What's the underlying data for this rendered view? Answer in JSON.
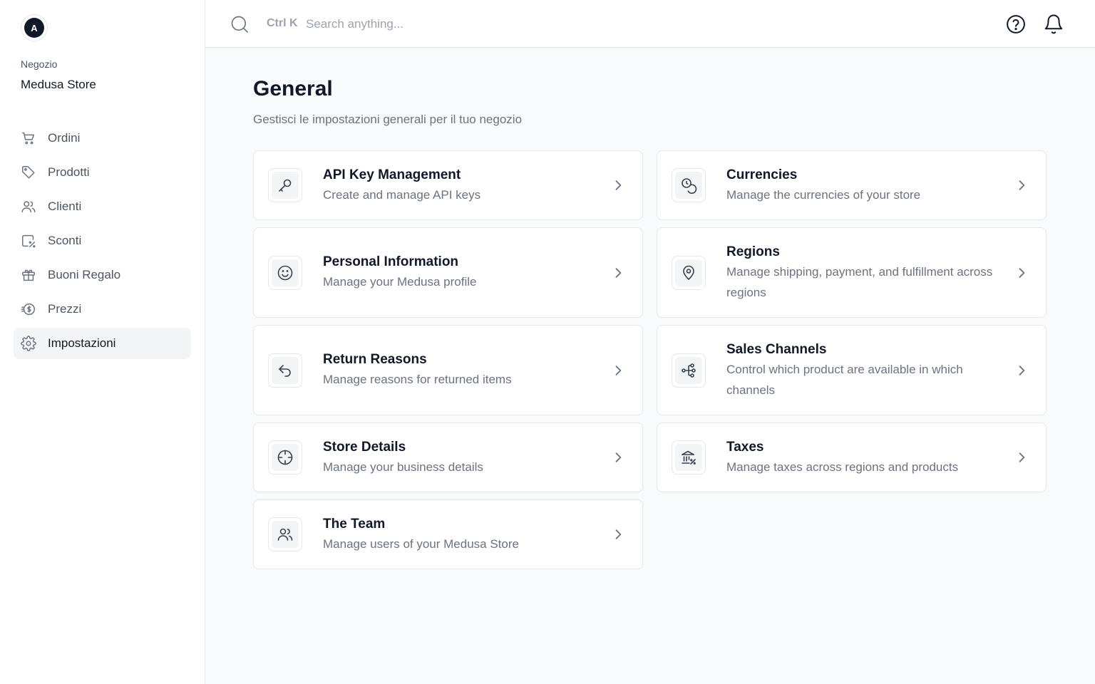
{
  "app": {
    "avatar_initial": "A",
    "store_label": "Negozio",
    "store_name": "Medusa Store"
  },
  "sidebar": {
    "items": [
      {
        "label": "Ordini",
        "icon": "cart-icon"
      },
      {
        "label": "Prodotti",
        "icon": "tag-icon"
      },
      {
        "label": "Clienti",
        "icon": "users-icon"
      },
      {
        "label": "Sconti",
        "icon": "discount-icon"
      },
      {
        "label": "Buoni Regalo",
        "icon": "gift-icon"
      },
      {
        "label": "Prezzi",
        "icon": "coin-icon"
      },
      {
        "label": "Impostazioni",
        "icon": "gear-icon",
        "active": true
      }
    ]
  },
  "topbar": {
    "shortcut": "Ctrl K",
    "search_placeholder": "Search anything..."
  },
  "page": {
    "title": "General",
    "subtitle": "Gestisci le impostazioni generali per il tuo negozio"
  },
  "cards": [
    {
      "title": "API Key Management",
      "desc": "Create and manage API keys",
      "icon": "key-icon"
    },
    {
      "title": "Currencies",
      "desc": "Manage the currencies of your store",
      "icon": "coins-icon"
    },
    {
      "title": "Personal Information",
      "desc": "Manage your Medusa profile",
      "icon": "smiley-icon"
    },
    {
      "title": "Regions",
      "desc": "Manage shipping, payment, and fulfillment across regions",
      "icon": "map-pin-icon"
    },
    {
      "title": "Return Reasons",
      "desc": "Manage reasons for returned items",
      "icon": "return-arrow-icon"
    },
    {
      "title": "Sales Channels",
      "desc": "Control which product are available in which channels",
      "icon": "channels-icon"
    },
    {
      "title": "Store Details",
      "desc": "Manage your business details",
      "icon": "crosshair-icon"
    },
    {
      "title": "Taxes",
      "desc": "Manage taxes across regions and products",
      "icon": "tax-building-icon"
    },
    {
      "title": "The Team",
      "desc": "Manage users of your Medusa Store",
      "icon": "team-icon"
    }
  ],
  "colors": {
    "text_primary": "#111827",
    "text_secondary": "#6b7280",
    "border": "#e5e7eb",
    "background": "#f9fafb"
  }
}
